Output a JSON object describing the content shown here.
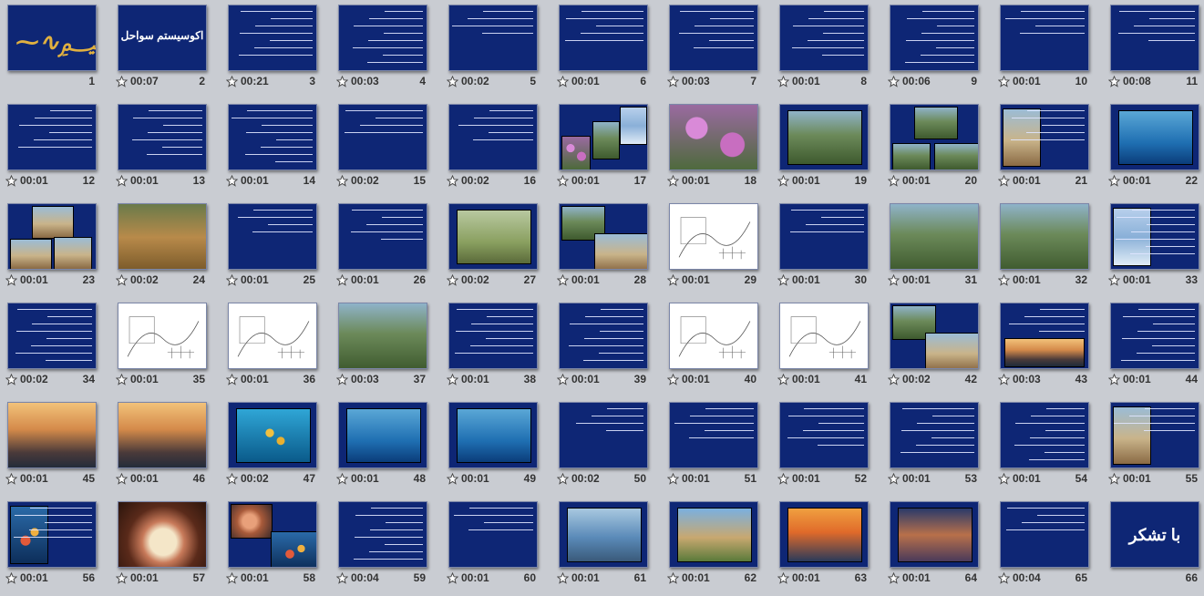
{
  "app": {
    "view": "Slide Sorter"
  },
  "colors": {
    "slide_bg": "#0e2675",
    "page_bg": "#c9ccd2",
    "caption_text": "#333333"
  },
  "slides": [
    {
      "n": "1",
      "t": "",
      "kind": "calligraphy"
    },
    {
      "n": "2",
      "t": "00:07",
      "kind": "title",
      "label": "اکوسیستم سواحل"
    },
    {
      "n": "3",
      "t": "00:21",
      "kind": "text"
    },
    {
      "n": "4",
      "t": "00:03",
      "kind": "text"
    },
    {
      "n": "5",
      "t": "00:02",
      "kind": "text"
    },
    {
      "n": "6",
      "t": "00:01",
      "kind": "text"
    },
    {
      "n": "7",
      "t": "00:03",
      "kind": "text"
    },
    {
      "n": "8",
      "t": "00:01",
      "kind": "text"
    },
    {
      "n": "9",
      "t": "00:06",
      "kind": "text"
    },
    {
      "n": "10",
      "t": "00:01",
      "kind": "text"
    },
    {
      "n": "11",
      "t": "00:08",
      "kind": "text"
    },
    {
      "n": "12",
      "t": "00:01",
      "kind": "text"
    },
    {
      "n": "13",
      "t": "00:01",
      "kind": "text"
    },
    {
      "n": "14",
      "t": "00:01",
      "kind": "text"
    },
    {
      "n": "15",
      "t": "00:02",
      "kind": "text"
    },
    {
      "n": "16",
      "t": "00:02",
      "kind": "text"
    },
    {
      "n": "17",
      "t": "00:01",
      "kind": "photos3"
    },
    {
      "n": "18",
      "t": "00:01",
      "kind": "photo",
      "style": "p-flower"
    },
    {
      "n": "19",
      "t": "00:01",
      "kind": "photo-inset",
      "style": "p-green"
    },
    {
      "n": "20",
      "t": "00:01",
      "kind": "photos3b"
    },
    {
      "n": "21",
      "t": "00:01",
      "kind": "photo-left"
    },
    {
      "n": "22",
      "t": "00:01",
      "kind": "photo-inset",
      "style": "p-sea"
    },
    {
      "n": "23",
      "t": "00:01",
      "kind": "photos3c"
    },
    {
      "n": "24",
      "t": "00:02",
      "kind": "photo",
      "style": "p-animal"
    },
    {
      "n": "25",
      "t": "00:01",
      "kind": "text"
    },
    {
      "n": "26",
      "t": "00:01",
      "kind": "text"
    },
    {
      "n": "27",
      "t": "00:02",
      "kind": "photo-inset",
      "style": "p-bird"
    },
    {
      "n": "28",
      "t": "00:01",
      "kind": "photos2"
    },
    {
      "n": "29",
      "t": "00:01",
      "kind": "drawing"
    },
    {
      "n": "30",
      "t": "00:01",
      "kind": "text"
    },
    {
      "n": "31",
      "t": "00:01",
      "kind": "photo",
      "style": "p-green"
    },
    {
      "n": "32",
      "t": "00:01",
      "kind": "photo",
      "style": "p-green"
    },
    {
      "n": "33",
      "t": "00:01",
      "kind": "photo-left",
      "style": "p-sky"
    },
    {
      "n": "34",
      "t": "00:02",
      "kind": "text"
    },
    {
      "n": "35",
      "t": "00:01",
      "kind": "drawing"
    },
    {
      "n": "36",
      "t": "00:01",
      "kind": "drawing"
    },
    {
      "n": "37",
      "t": "00:03",
      "kind": "photo",
      "style": "p-green"
    },
    {
      "n": "38",
      "t": "00:01",
      "kind": "text"
    },
    {
      "n": "39",
      "t": "00:01",
      "kind": "text"
    },
    {
      "n": "40",
      "t": "00:01",
      "kind": "drawing"
    },
    {
      "n": "41",
      "t": "00:01",
      "kind": "drawing"
    },
    {
      "n": "42",
      "t": "00:02",
      "kind": "photos2"
    },
    {
      "n": "43",
      "t": "00:03",
      "kind": "text-photo",
      "style": "p-sunset"
    },
    {
      "n": "44",
      "t": "00:01",
      "kind": "text"
    },
    {
      "n": "45",
      "t": "00:01",
      "kind": "photo",
      "style": "p-sunset"
    },
    {
      "n": "46",
      "t": "00:01",
      "kind": "photo",
      "style": "p-sunset"
    },
    {
      "n": "47",
      "t": "00:02",
      "kind": "photo-inset",
      "style": "p-diver"
    },
    {
      "n": "48",
      "t": "00:01",
      "kind": "photo-inset",
      "style": "p-sea"
    },
    {
      "n": "49",
      "t": "00:01",
      "kind": "photo-inset",
      "style": "p-sea"
    },
    {
      "n": "50",
      "t": "00:02",
      "kind": "text"
    },
    {
      "n": "51",
      "t": "00:01",
      "kind": "text"
    },
    {
      "n": "52",
      "t": "00:01",
      "kind": "text"
    },
    {
      "n": "53",
      "t": "00:01",
      "kind": "text"
    },
    {
      "n": "54",
      "t": "00:01",
      "kind": "text"
    },
    {
      "n": "55",
      "t": "00:01",
      "kind": "photo-left",
      "style": "p-desert"
    },
    {
      "n": "56",
      "t": "00:01",
      "kind": "photo-left",
      "style": "p-reef"
    },
    {
      "n": "57",
      "t": "00:01",
      "kind": "photo",
      "style": "p-anemone"
    },
    {
      "n": "58",
      "t": "00:01",
      "kind": "photos2b"
    },
    {
      "n": "59",
      "t": "00:04",
      "kind": "text"
    },
    {
      "n": "60",
      "t": "00:01",
      "kind": "text"
    },
    {
      "n": "61",
      "t": "00:01",
      "kind": "photo-inset",
      "style": "p-boat"
    },
    {
      "n": "62",
      "t": "00:01",
      "kind": "photo-inset",
      "style": "p-hut"
    },
    {
      "n": "63",
      "t": "00:01",
      "kind": "photo-inset",
      "style": "p-dolphin"
    },
    {
      "n": "64",
      "t": "00:01",
      "kind": "photo-inset",
      "style": "p-city"
    },
    {
      "n": "65",
      "t": "00:04",
      "kind": "text"
    },
    {
      "n": "66",
      "t": "",
      "kind": "title",
      "label": "با تشکر"
    }
  ]
}
